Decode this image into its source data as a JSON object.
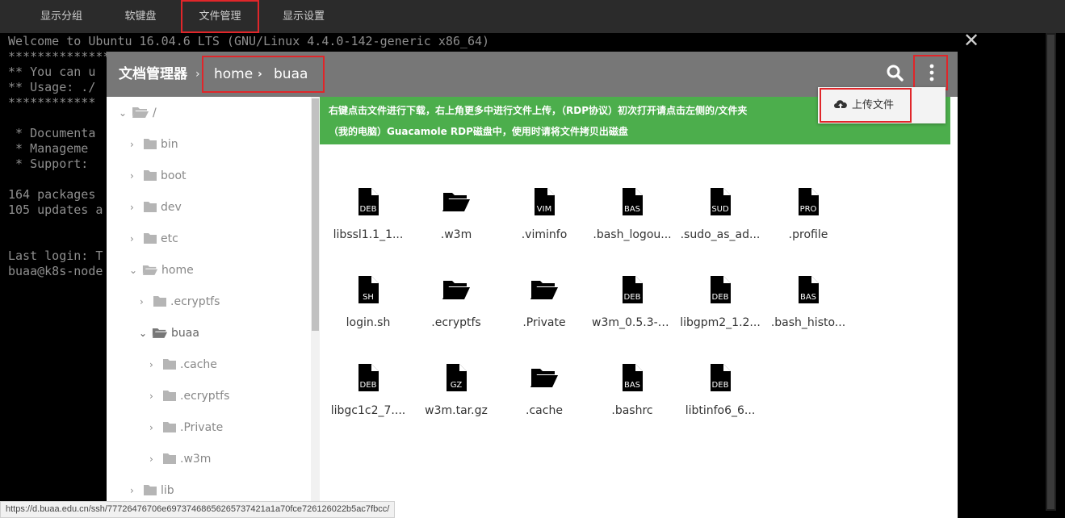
{
  "topbar": {
    "items": [
      {
        "label": "显示分组",
        "active": false
      },
      {
        "label": "软键盘",
        "active": false
      },
      {
        "label": "文件管理",
        "active": true
      },
      {
        "label": "显示设置",
        "active": false
      }
    ]
  },
  "terminal": {
    "lines": [
      "Welcome to Ubuntu 16.04.6 LTS (GNU/Linux 4.4.0-142-generic x86_64)",
      "****************************************************",
      "** You can u",
      "** Usage: ./",
      "************",
      "",
      " * Documenta",
      " * Manageme",
      " * Support:",
      "",
      "164 packages",
      "105 updates a",
      "",
      "",
      "Last login: T",
      "buaa@k8s-node"
    ],
    "close_glyph": "✕"
  },
  "file_manager": {
    "title": "文档管理器",
    "separator": "›",
    "breadcrumb": [
      "home",
      "buaa"
    ],
    "upload_menu_item": "上传文件",
    "notice_line1": "右键点击文件进行下载，右上角更多中进行文件上传，（RDP协议）初次打开请点击左侧的/文件夹",
    "notice_line2": "（我的电脑）Guacamole RDP磁盘中，使用时请将文件拷贝出磁盘",
    "tree": [
      {
        "label": "/",
        "open": true,
        "depth": 0
      },
      {
        "label": "bin",
        "open": false,
        "depth": 1
      },
      {
        "label": "boot",
        "open": false,
        "depth": 1
      },
      {
        "label": "dev",
        "open": false,
        "depth": 1
      },
      {
        "label": "etc",
        "open": false,
        "depth": 1
      },
      {
        "label": "home",
        "open": true,
        "depth": 1
      },
      {
        "label": ".ecryptfs",
        "open": false,
        "depth": 2
      },
      {
        "label": "buaa",
        "open": true,
        "depth": 2
      },
      {
        "label": ".cache",
        "open": false,
        "depth": 3
      },
      {
        "label": ".ecryptfs",
        "open": false,
        "depth": 3
      },
      {
        "label": ".Private",
        "open": false,
        "depth": 3
      },
      {
        "label": ".w3m",
        "open": false,
        "depth": 3
      },
      {
        "label": "lib",
        "open": false,
        "depth": 1
      }
    ],
    "files": [
      {
        "name": "libssl1.1_1...",
        "kind": "file",
        "ext": "DEB"
      },
      {
        "name": ".w3m",
        "kind": "folder",
        "ext": ""
      },
      {
        "name": ".viminfo",
        "kind": "file",
        "ext": "VIM"
      },
      {
        "name": ".bash_logou...",
        "kind": "file",
        "ext": "BAS"
      },
      {
        "name": ".sudo_as_ad...",
        "kind": "file",
        "ext": "SUD"
      },
      {
        "name": ".profile",
        "kind": "file",
        "ext": "PRO"
      },
      {
        "name": "login.sh",
        "kind": "file",
        "ext": "SH"
      },
      {
        "name": ".ecryptfs",
        "kind": "folder",
        "ext": ""
      },
      {
        "name": ".Private",
        "kind": "folder",
        "ext": ""
      },
      {
        "name": "w3m_0.5.3-3...",
        "kind": "file",
        "ext": "DEB"
      },
      {
        "name": "libgpm2_1.2...",
        "kind": "file",
        "ext": "DEB"
      },
      {
        "name": ".bash_histo...",
        "kind": "file",
        "ext": "BAS"
      },
      {
        "name": "libgc1c2_7....",
        "kind": "file",
        "ext": "DEB"
      },
      {
        "name": "w3m.tar.gz",
        "kind": "file",
        "ext": "GZ"
      },
      {
        "name": ".cache",
        "kind": "folder",
        "ext": ""
      },
      {
        "name": ".bashrc",
        "kind": "file",
        "ext": "BAS"
      },
      {
        "name": "libtinfo6_6...",
        "kind": "file",
        "ext": "DEB"
      }
    ]
  },
  "status_url": "https://d.buaa.edu.cn/ssh/77726476706e69737468656265737421a1a70fce726126022b5ac7fbcc/",
  "colors": {
    "accent_red": "#e0262a",
    "notice_green": "#4cae4c",
    "header_gray": "#777777",
    "topbar_bg": "#2b2b2b"
  }
}
